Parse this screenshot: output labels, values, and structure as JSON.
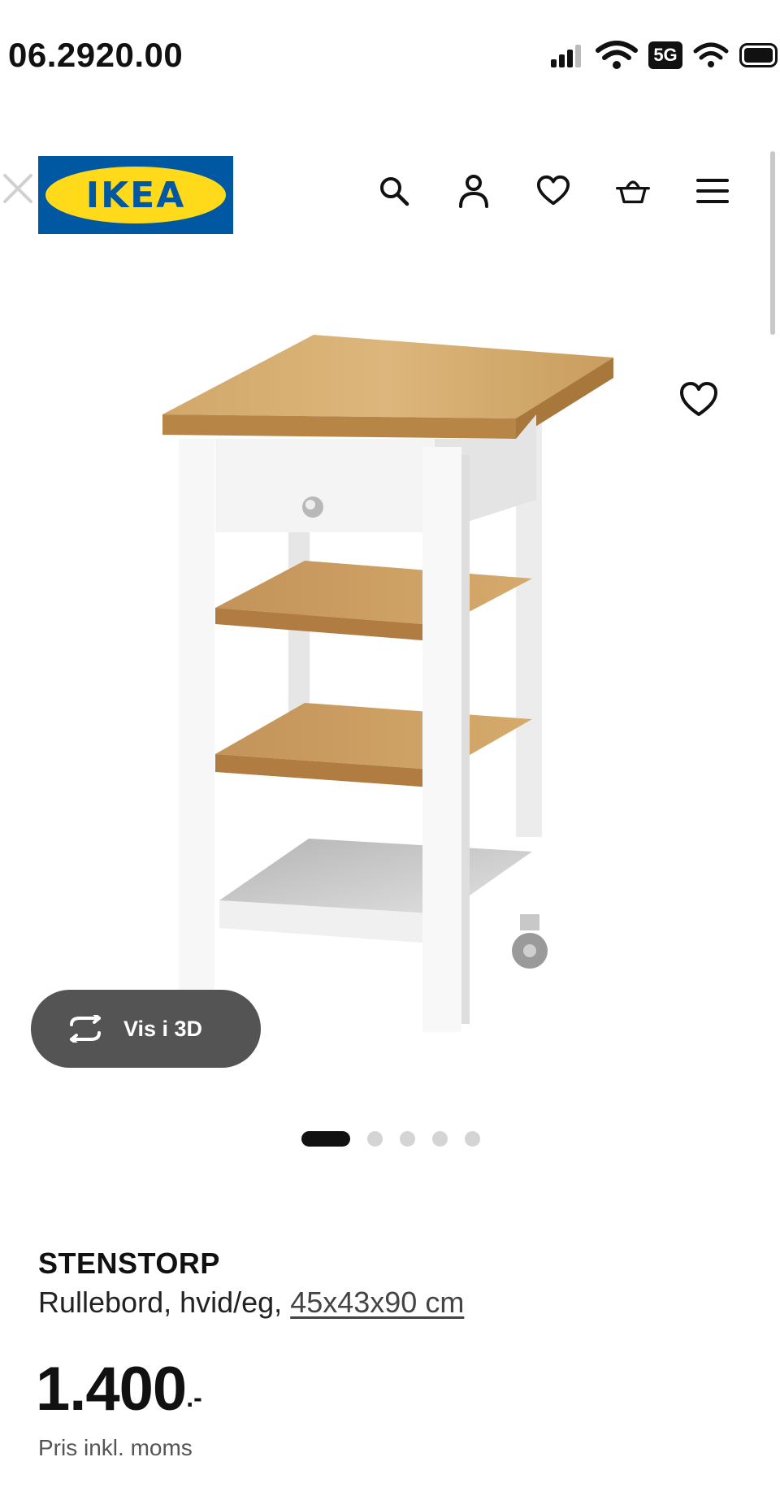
{
  "status_bar": {
    "time": "06.2920.00",
    "network": "5G",
    "icons": [
      "signal-icon",
      "wifi-icon",
      "5g-icon",
      "battery-icon"
    ]
  },
  "header": {
    "logo_text": "IKEA",
    "icons": [
      "close-icon",
      "search-icon",
      "account-icon",
      "wishlist-heart-icon",
      "basket-icon",
      "menu-icon"
    ],
    "colors": {
      "logo_blue": "#0058a3",
      "logo_yellow": "#ffda1a"
    }
  },
  "gallery": {
    "view_3d_label": "Vis i 3D",
    "dot_count": 5,
    "active_dot": 1
  },
  "product": {
    "name": "STENSTORP",
    "description": "Rullebord, hvid/eg,",
    "dimensions": "45x43x90 cm",
    "price": "1.400",
    "price_suffix": ".-",
    "price_note": "Pris inkl. moms"
  }
}
